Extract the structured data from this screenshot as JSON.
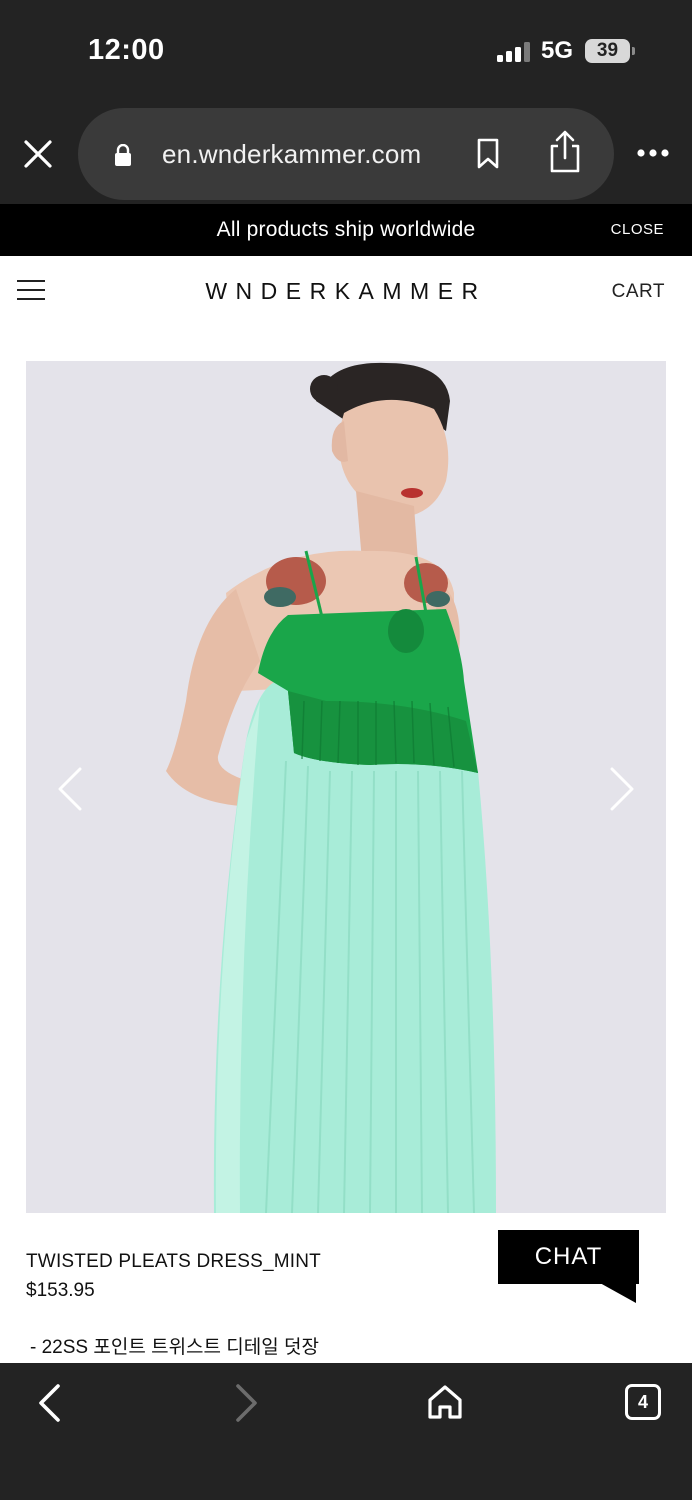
{
  "status_bar": {
    "time": "12:00",
    "network": "5G",
    "battery": "39"
  },
  "browser": {
    "url": "en.wnderkammer.com",
    "tab_count": "4"
  },
  "announcement": {
    "text": "All products ship worldwide",
    "close_label": "CLOSE"
  },
  "header": {
    "brand": "WNDERKAMMER",
    "cart_label": "CART"
  },
  "product": {
    "name": "TWISTED PLEATS DRESS_MINT",
    "price": "$153.95",
    "description": "- 22SS 포인트 트위스트 디테일 덧장"
  },
  "chat": {
    "label": "CHAT"
  },
  "colors": {
    "chrome_bg": "#232323",
    "announce_bg": "#000000",
    "photo_bg": "#e4e3ea",
    "dress_green": "#1aa64a",
    "dress_mint": "#a8ecd8"
  }
}
